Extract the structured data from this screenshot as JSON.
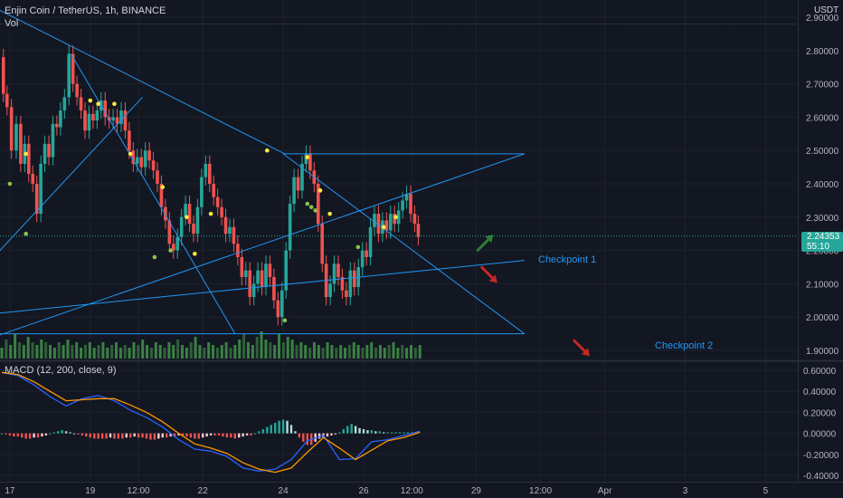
{
  "header": {
    "symbol": "Enjin Coin / TetherUS, 1h, BINANCE",
    "volume_label": "Vol",
    "currency": "USDT"
  },
  "current_price": {
    "value": "2.24353",
    "countdown": "55:10",
    "level": 2.2435
  },
  "annotations": {
    "checkpoint1": "Checkpoint  1",
    "checkpoint2": "Checkpoint  2"
  },
  "colors": {
    "background": "#131722",
    "up": "#26a69a",
    "down": "#ef5350",
    "trendline": "#2196f3",
    "macd": "#2962ff",
    "signal": "#ff9800",
    "volume": "#4caf50"
  },
  "chart_data": [
    {
      "type": "candlestick",
      "symbol": "ENJUSDT",
      "interval": "1h",
      "exchange": "BINANCE",
      "y_ticks": [
        1.9,
        2.0,
        2.1,
        2.2,
        2.3,
        2.4,
        2.5,
        2.6,
        2.7,
        2.8,
        2.9
      ],
      "y_tick_labels": [
        "1.90000",
        "2.00000",
        "2.10000",
        "2.20000",
        "2.30000",
        "2.40000",
        "2.50000",
        "2.60000",
        "2.70000",
        "2.80000",
        "2.90000"
      ],
      "ylim": [
        1.87,
        2.93
      ],
      "x_tick_labels": [
        "17",
        "19",
        "12:00",
        "22",
        "24",
        "26",
        "12:00",
        "29",
        "12:00",
        "Apr",
        "3",
        "5"
      ],
      "x_tick_units": [
        2,
        12,
        18,
        26,
        36,
        46,
        52,
        60,
        68,
        76,
        86,
        96
      ],
      "x_range_units": [
        1,
        100
      ],
      "x_unit": "12h",
      "series_path_points": [
        [
          1.0,
          2.78
        ],
        [
          1.4,
          2.67
        ],
        [
          1.9,
          2.63
        ],
        [
          2.5,
          2.5
        ],
        [
          3.1,
          2.58
        ],
        [
          3.6,
          2.46
        ],
        [
          4.1,
          2.52
        ],
        [
          4.6,
          2.43
        ],
        [
          5.1,
          2.4
        ],
        [
          5.6,
          2.31
        ],
        [
          6.1,
          2.46
        ],
        [
          6.6,
          2.52
        ],
        [
          7.1,
          2.48
        ],
        [
          7.6,
          2.58
        ],
        [
          8.1,
          2.57
        ],
        [
          8.5,
          2.62
        ],
        [
          9.1,
          2.66
        ],
        [
          9.6,
          2.79
        ],
        [
          10.1,
          2.7
        ],
        [
          10.6,
          2.66
        ],
        [
          11.1,
          2.62
        ],
        [
          11.6,
          2.56
        ],
        [
          12.1,
          2.61
        ],
        [
          12.6,
          2.59
        ],
        [
          13.1,
          2.62
        ],
        [
          13.6,
          2.65
        ],
        [
          14.1,
          2.6
        ],
        [
          14.6,
          2.59
        ],
        [
          15.1,
          2.6
        ],
        [
          15.6,
          2.58
        ],
        [
          16.1,
          2.62
        ],
        [
          16.6,
          2.56
        ],
        [
          17.1,
          2.5
        ],
        [
          17.6,
          2.46
        ],
        [
          18.1,
          2.48
        ],
        [
          18.6,
          2.45
        ],
        [
          19.1,
          2.5
        ],
        [
          19.6,
          2.47
        ],
        [
          20.1,
          2.44
        ],
        [
          20.6,
          2.4
        ],
        [
          21.1,
          2.33
        ],
        [
          21.6,
          2.29
        ],
        [
          22.1,
          2.22
        ],
        [
          22.6,
          2.2
        ],
        [
          23.1,
          2.24
        ],
        [
          23.6,
          2.3
        ],
        [
          24.1,
          2.34
        ],
        [
          24.6,
          2.28
        ],
        [
          25.1,
          2.25
        ],
        [
          25.6,
          2.33
        ],
        [
          26.1,
          2.42
        ],
        [
          26.6,
          2.46
        ],
        [
          27.1,
          2.4
        ],
        [
          27.6,
          2.36
        ],
        [
          28.1,
          2.33
        ],
        [
          28.6,
          2.3
        ],
        [
          29.1,
          2.25
        ],
        [
          29.6,
          2.27
        ],
        [
          30.1,
          2.22
        ],
        [
          30.6,
          2.18
        ],
        [
          31.1,
          2.12
        ],
        [
          31.6,
          2.14
        ],
        [
          32.1,
          2.06
        ],
        [
          32.6,
          2.1
        ],
        [
          33.1,
          2.14
        ],
        [
          33.6,
          2.09
        ],
        [
          34.1,
          2.16
        ],
        [
          34.6,
          2.12
        ],
        [
          35.1,
          2.05
        ],
        [
          35.6,
          2.0
        ],
        [
          36.1,
          2.08
        ],
        [
          36.6,
          2.2
        ],
        [
          37.1,
          2.34
        ],
        [
          37.6,
          2.42
        ],
        [
          38.1,
          2.38
        ],
        [
          38.6,
          2.46
        ],
        [
          39.1,
          2.49
        ],
        [
          39.6,
          2.44
        ],
        [
          40.1,
          2.4
        ],
        [
          40.6,
          2.28
        ],
        [
          41.1,
          2.16
        ],
        [
          41.6,
          2.06
        ],
        [
          42.1,
          2.1
        ],
        [
          42.6,
          2.16
        ],
        [
          43.1,
          2.12
        ],
        [
          43.6,
          2.08
        ],
        [
          44.1,
          2.06
        ],
        [
          44.6,
          2.14
        ],
        [
          45.1,
          2.09
        ],
        [
          45.6,
          2.15
        ],
        [
          46.1,
          2.2
        ],
        [
          46.6,
          2.18
        ],
        [
          47.1,
          2.27
        ],
        [
          47.6,
          2.31
        ],
        [
          48.1,
          2.25
        ],
        [
          48.6,
          2.29
        ],
        [
          49.1,
          2.26
        ],
        [
          49.6,
          2.31
        ],
        [
          50.1,
          2.28
        ],
        [
          50.6,
          2.32
        ],
        [
          51.1,
          2.35
        ],
        [
          51.6,
          2.37
        ],
        [
          52.1,
          2.31
        ],
        [
          52.6,
          2.28
        ],
        [
          53.0,
          2.24
        ]
      ],
      "volume_heights_rel": [
        0.4,
        0.7,
        0.5,
        0.9,
        0.6,
        0.5,
        0.8,
        0.6,
        0.5,
        0.7,
        0.6,
        0.5,
        0.4,
        0.6,
        0.5,
        0.7,
        0.5,
        0.6,
        0.4,
        0.5,
        0.6,
        0.4,
        0.5,
        0.6,
        0.4,
        0.5,
        0.6,
        0.4,
        0.5,
        0.4,
        0.6,
        0.5,
        0.7,
        0.5,
        0.4,
        0.6,
        0.5,
        0.4,
        0.6,
        0.5,
        0.7,
        0.5,
        0.4,
        0.6,
        0.8,
        0.5,
        0.4,
        0.6,
        0.5,
        0.4,
        0.5,
        0.6,
        0.4,
        0.5,
        0.7,
        0.9,
        0.6,
        0.5,
        0.8,
        1.0,
        0.7,
        0.6,
        0.5,
        0.9,
        0.6,
        0.8,
        0.7,
        0.5,
        0.6,
        0.5,
        0.4,
        0.6,
        0.5,
        0.4,
        0.6,
        0.5,
        0.4,
        0.5,
        0.4,
        0.5,
        0.6,
        0.5,
        0.4,
        0.5,
        0.6,
        0.4,
        0.5,
        0.4,
        0.5,
        0.6,
        0.4,
        0.5,
        0.4,
        0.5,
        0.4,
        0.5
      ],
      "drawings": [
        {
          "kind": "trendline",
          "from": [
            0,
            2.93
          ],
          "to": [
            36.2,
            2.49
          ]
        },
        {
          "kind": "trendline",
          "from": [
            9.6,
            2.79
          ],
          "to": [
            30.0,
            1.95
          ]
        },
        {
          "kind": "trendline",
          "from": [
            0,
            2.18
          ],
          "to": [
            18.5,
            2.66
          ]
        },
        {
          "kind": "trendline",
          "from": [
            36.0,
            2.49
          ],
          "to": [
            66.0,
            1.95
          ]
        },
        {
          "kind": "trendline",
          "from": [
            0,
            1.94
          ],
          "to": [
            66.0,
            2.49
          ]
        },
        {
          "kind": "trendline",
          "from": [
            0,
            2.01
          ],
          "to": [
            66.0,
            2.17
          ]
        },
        {
          "kind": "horizontal",
          "from": [
            36.0,
            2.49
          ],
          "to": [
            66.0,
            2.49
          ]
        },
        {
          "kind": "horizontal",
          "from": [
            0,
            1.95
          ],
          "to": [
            66.0,
            1.95
          ]
        }
      ],
      "markers_yellow": [
        [
          4.0,
          2.49
        ],
        [
          12.0,
          2.65
        ],
        [
          13.0,
          2.64
        ],
        [
          15.0,
          2.64
        ],
        [
          17.0,
          2.49
        ],
        [
          21.0,
          2.39
        ],
        [
          24.0,
          2.3
        ],
        [
          25.0,
          2.19
        ],
        [
          27.0,
          2.31
        ],
        [
          34.0,
          2.5
        ],
        [
          39.0,
          2.48
        ],
        [
          40.6,
          2.38
        ],
        [
          41.8,
          2.31
        ],
        [
          48.5,
          2.27
        ],
        [
          50.0,
          2.3
        ]
      ],
      "markers_green": [
        [
          2.0,
          2.4
        ],
        [
          4.0,
          2.25
        ],
        [
          20.0,
          2.18
        ],
        [
          22.0,
          2.2
        ],
        [
          36.2,
          1.99
        ],
        [
          39.0,
          2.34
        ],
        [
          39.5,
          2.33
        ],
        [
          40.0,
          2.32
        ],
        [
          45.3,
          2.21
        ]
      ],
      "arrows": [
        {
          "color": "up",
          "at": [
            61.0,
            2.22
          ],
          "direction": "up"
        },
        {
          "color": "down",
          "at": [
            61.5,
            2.13
          ],
          "direction": "down"
        },
        {
          "color": "down",
          "at": [
            73.0,
            1.91
          ],
          "direction": "down"
        }
      ]
    },
    {
      "type": "line",
      "title": "MACD (12, 200, close, 9)",
      "y_ticks": [
        -0.4,
        -0.2,
        0.0,
        0.2,
        0.4,
        0.6
      ],
      "y_tick_labels": [
        "-0.40000",
        "-0.20000",
        "0.00000",
        "0.20000",
        "0.40000",
        "0.60000"
      ],
      "ylim": [
        -0.46,
        0.66
      ],
      "series": [
        {
          "name": "MACD",
          "x": [
            1,
            3,
            5,
            7,
            9,
            11,
            13,
            15,
            17,
            19,
            21,
            23,
            25,
            27,
            29,
            31,
            33,
            35,
            37,
            39,
            41,
            43,
            45,
            47,
            49,
            51,
            53
          ],
          "values": [
            0.58,
            0.55,
            0.46,
            0.35,
            0.26,
            0.33,
            0.36,
            0.31,
            0.22,
            0.15,
            0.06,
            -0.06,
            -0.15,
            -0.17,
            -0.22,
            -0.33,
            -0.36,
            -0.34,
            -0.25,
            -0.07,
            -0.02,
            -0.25,
            -0.24,
            -0.08,
            -0.06,
            -0.02,
            0.02
          ]
        },
        {
          "name": "Signal",
          "x": [
            1,
            3,
            5,
            7,
            9,
            11,
            13,
            15,
            17,
            19,
            21,
            23,
            25,
            27,
            29,
            31,
            33,
            35,
            37,
            39,
            41,
            43,
            45,
            47,
            49,
            51,
            53
          ],
          "values": [
            0.58,
            0.56,
            0.49,
            0.4,
            0.31,
            0.32,
            0.33,
            0.33,
            0.27,
            0.2,
            0.11,
            0.0,
            -0.1,
            -0.14,
            -0.19,
            -0.28,
            -0.34,
            -0.37,
            -0.33,
            -0.18,
            -0.04,
            -0.14,
            -0.25,
            -0.16,
            -0.07,
            -0.04,
            0.01
          ]
        }
      ],
      "histogram": {
        "x_start": 1,
        "x_step": 0.5,
        "values": [
          0.0,
          -0.01,
          -0.02,
          -0.03,
          -0.03,
          -0.04,
          -0.05,
          -0.05,
          -0.04,
          -0.04,
          -0.03,
          -0.02,
          0.0,
          0.01,
          0.02,
          0.03,
          0.02,
          0.01,
          0.0,
          -0.01,
          -0.02,
          -0.03,
          -0.04,
          -0.05,
          -0.05,
          -0.05,
          -0.05,
          -0.04,
          -0.05,
          -0.05,
          -0.05,
          -0.04,
          -0.04,
          -0.03,
          -0.04,
          -0.04,
          -0.05,
          -0.06,
          -0.06,
          -0.05,
          -0.04,
          -0.04,
          -0.03,
          -0.03,
          -0.02,
          -0.03,
          -0.03,
          -0.04,
          -0.05,
          -0.05,
          -0.04,
          -0.03,
          -0.02,
          -0.02,
          -0.02,
          -0.03,
          -0.04,
          -0.04,
          -0.05,
          -0.04,
          -0.03,
          -0.02,
          -0.02,
          0.0,
          0.02,
          0.04,
          0.06,
          0.08,
          0.1,
          0.12,
          0.13,
          0.12,
          0.08,
          0.02,
          -0.04,
          -0.08,
          -0.11,
          -0.11,
          -0.08,
          -0.05,
          -0.04,
          -0.03,
          -0.02,
          -0.01,
          0.01,
          0.04,
          0.07,
          0.09,
          0.07,
          0.05,
          0.04,
          0.03,
          0.03,
          0.02,
          0.02,
          0.01,
          0.01,
          0.01,
          0.01,
          0.01,
          0.01,
          0.01,
          0.01
        ]
      }
    }
  ]
}
